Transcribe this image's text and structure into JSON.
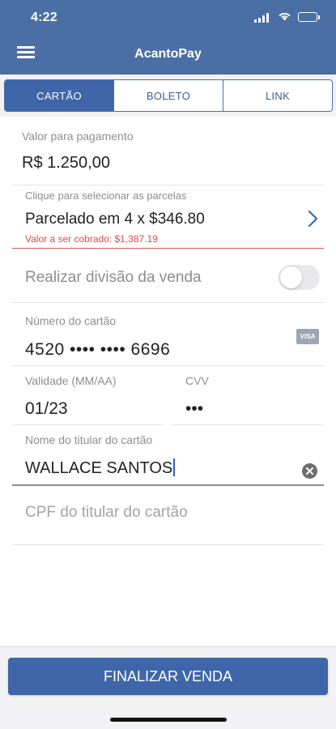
{
  "status_bar": {
    "time": "4:22"
  },
  "header": {
    "title": "AcantoPay"
  },
  "tabs": [
    {
      "label": "CARTÃO",
      "active": true
    },
    {
      "label": "BOLETO",
      "active": false
    },
    {
      "label": "LINK",
      "active": false
    }
  ],
  "form": {
    "amount": {
      "label": "Valor para pagamento",
      "value": "R$ 1.250,00"
    },
    "installments": {
      "label": "Clique para selecionar as parcelas",
      "value": "Parcelado em 4 x $346.80",
      "charged_note": "Valor a ser cobrado: $1,387.19"
    },
    "split_sale": {
      "label": "Realizar divisão da venda",
      "enabled": false
    },
    "card_number": {
      "label": "Número do cartão",
      "value": "4520 •••• •••• 6696",
      "brand": "VISA"
    },
    "expiry": {
      "label": "Validade (MM/AA)",
      "value": "01/23"
    },
    "cvv": {
      "label": "CVV",
      "value": "•••"
    },
    "holder_name": {
      "label": "Nome do titular do cartão",
      "value": "WALLACE SANTOS"
    },
    "holder_cpf": {
      "placeholder": "CPF do titular do cartão"
    }
  },
  "footer": {
    "submit_label": "FINALIZAR VENDA"
  },
  "colors": {
    "primary": "#3f66a8",
    "header": "#4a6fa5",
    "error": "#e04848"
  }
}
